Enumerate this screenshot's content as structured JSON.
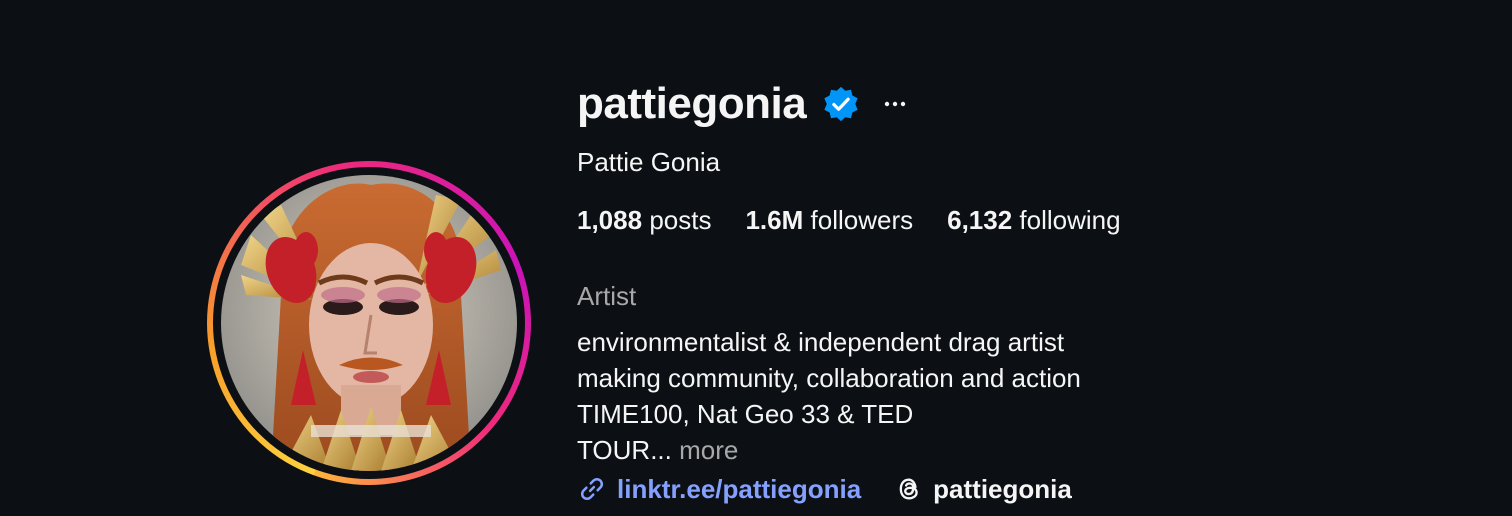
{
  "profile": {
    "username": "pattiegonia",
    "verified_icon": "verified-badge-icon",
    "full_name": "Pattie Gonia",
    "stats": {
      "posts_count": "1,088",
      "posts_label": "posts",
      "followers_count": "1.6M",
      "followers_label": "followers",
      "following_count": "6,132",
      "following_label": "following"
    },
    "category": "Artist",
    "bio_lines": [
      "environmentalist & independent drag artist",
      "making community, collaboration and action",
      "TIME100, Nat Geo 33 & TED",
      "TOUR..."
    ],
    "more_label": "more",
    "link_text": "linktr.ee/pattiegonia",
    "threads_handle": "pattiegonia"
  },
  "colors": {
    "background": "#0c1014",
    "text": "#f5f5f5",
    "secondary_text": "#a8a8a8",
    "link": "#85a1ff",
    "verified": "#0095f6"
  }
}
